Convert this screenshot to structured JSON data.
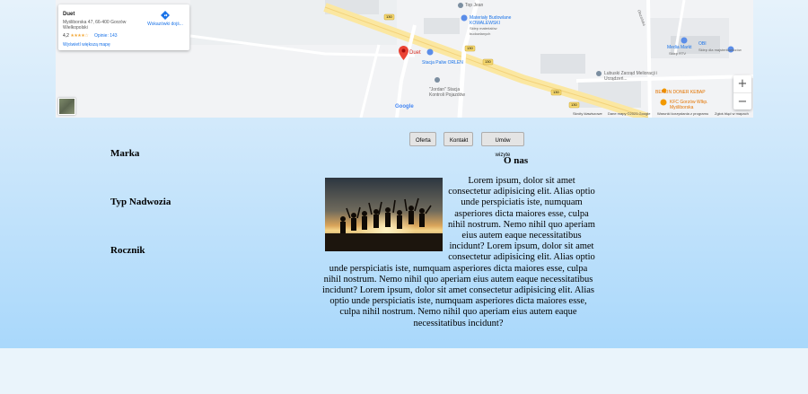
{
  "map": {
    "place_card": {
      "name": "Duet",
      "address": "Myśliborska 47, 66-400 Gorzów Wielkopolski",
      "rating": "4,2",
      "stars": "★★★★☆",
      "reviews": "Opinie: 143",
      "directions": "Wskazówki dojś...",
      "larger_map": "Wyświetl większą mapę"
    },
    "labels": {
      "top_jean": "Top Jean",
      "materialy": "Materiały Budowlane KOWALEWSKI",
      "materialy_sub": "Sklep materiałów budowlanych",
      "duet_pin": "Duet",
      "orlen": "Stacja Paliw ORLEN",
      "jordan": "\"Jordan\" Stacja Kontroli Pojazdów",
      "zarzad": "Lubuski Zarząd Melioracji i Urządzeń...",
      "media_markt": "Media Markt",
      "media_markt_sub": "Sklep RTV",
      "obi": "OBI",
      "obi_sub": "Sklep dla majsterkowiczów",
      "berlin": "BERLIN DONER KEBAP",
      "kfc": "KFC Gorzów Wlkp. Myśliborska",
      "street": "Olszańska",
      "road_130a": "130",
      "road_130b": "130",
      "road_130c": "130",
      "road_130d": "130",
      "road_130e": "130"
    },
    "zoom_in": "+",
    "zoom_out": "−",
    "google_logo": "Google",
    "attribution": {
      "shortcuts": "Skróty klawiszowe",
      "data": "Dane mapy ©2023 Google",
      "terms": "Warunki korzystania z programu",
      "report": "Zgłoś błąd w mapach"
    }
  },
  "nav": {
    "offer": "Oferta",
    "contact": "Kontakt",
    "appointment": "Umów wizyte"
  },
  "sidebar": {
    "brand": "Marka",
    "body_type": "Typ Nadwozia",
    "year": "Rocznik"
  },
  "about": {
    "heading": "O nas",
    "body": "Lorem ipsum, dolor sit amet consectetur adipisicing elit. Alias optio unde perspiciatis iste, numquam asperiores dicta maiores esse, culpa nihil nostrum. Nemo nihil quo aperiam eius autem eaque necessitatibus incidunt? Lorem ipsum, dolor sit amet consectetur adipisicing elit. Alias optio unde perspiciatis iste, numquam asperiores dicta maiores esse, culpa nihil nostrum. Nemo nihil quo aperiam eius autem eaque necessitatibus incidunt? Lorem ipsum, dolor sit amet consectetur adipisicing elit. Alias optio unde perspiciatis iste, numquam asperiores dicta maiores esse, culpa nihil nostrum. Nemo nihil quo aperiam eius autem eaque necessitatibus incidunt?"
  },
  "colors": {
    "link_blue": "#1a73e8",
    "pin_red": "#ea4335",
    "road_yellow": "#f5d76e"
  }
}
